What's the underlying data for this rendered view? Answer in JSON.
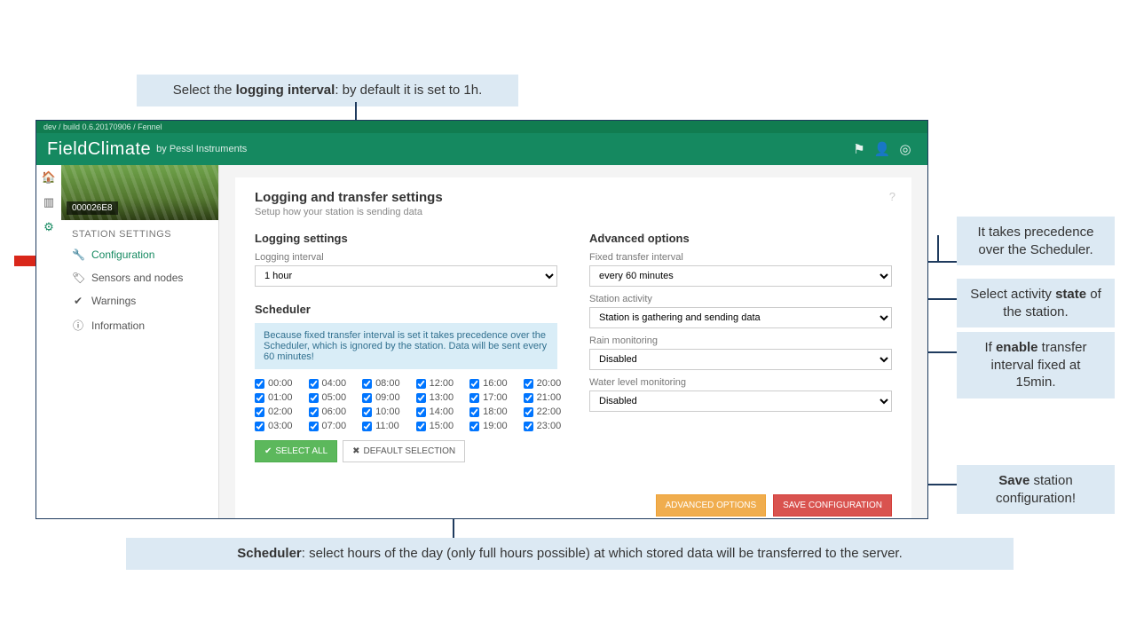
{
  "annotations": {
    "logging": {
      "pre": "Select the ",
      "bold": "logging interval",
      "post": ": by default it is set to 1h."
    },
    "scheduler": {
      "bold": "Scheduler",
      "post": ": select hours of the day (only full hours possible) at which stored data will be transferred to the server."
    },
    "fixed": "It takes precedence over the Scheduler.",
    "activity": {
      "pre": "Select activity ",
      "bold": "state",
      "post": " of the station."
    },
    "rain": {
      "pre": "If ",
      "bold": "enable",
      "post": " transfer interval fixed at 15min."
    },
    "save": {
      "bold": "Save",
      "post": " station configuration!"
    }
  },
  "build_line": "dev / build 0.6.20170906 / Fennel",
  "brand": {
    "main": "FieldClimate",
    "sub": "by Pessl Instruments"
  },
  "station_id": "000026E8",
  "sidebar": {
    "title": "STATION SETTINGS",
    "items": [
      {
        "icon": "🔧",
        "label": "Configuration",
        "active": true
      },
      {
        "icon": "🏷",
        "label": "Sensors and nodes"
      },
      {
        "icon": "✔",
        "label": "Warnings"
      },
      {
        "icon": "ⓘ",
        "label": "Information"
      }
    ]
  },
  "page": {
    "title": "Logging and transfer settings",
    "subtitle": "Setup how your station is sending data",
    "logging": {
      "section": "Logging settings",
      "interval_label": "Logging interval",
      "interval_value": "1 hour"
    },
    "scheduler": {
      "section": "Scheduler",
      "info": "Because fixed transfer interval is set it takes precedence over the Scheduler, which is ignored by the station. Data will be sent every 60 minutes!",
      "hours": [
        [
          "00:00",
          "01:00",
          "02:00",
          "03:00"
        ],
        [
          "04:00",
          "05:00",
          "06:00",
          "07:00"
        ],
        [
          "08:00",
          "09:00",
          "10:00",
          "11:00"
        ],
        [
          "12:00",
          "13:00",
          "14:00",
          "15:00"
        ],
        [
          "16:00",
          "17:00",
          "18:00",
          "19:00"
        ],
        [
          "20:00",
          "21:00",
          "22:00",
          "23:00"
        ]
      ],
      "select_all": "SELECT ALL",
      "default": "DEFAULT SELECTION"
    },
    "advanced": {
      "section": "Advanced options",
      "fixed_label": "Fixed transfer interval",
      "fixed_value": "every 60 minutes",
      "activity_label": "Station activity",
      "activity_value": "Station is gathering and sending data",
      "rain_label": "Rain monitoring",
      "rain_value": "Disabled",
      "water_label": "Water level monitoring",
      "water_value": "Disabled"
    },
    "footer": {
      "advanced": "ADVANCED OPTIONS",
      "save": "SAVE CONFIGURATION"
    }
  }
}
